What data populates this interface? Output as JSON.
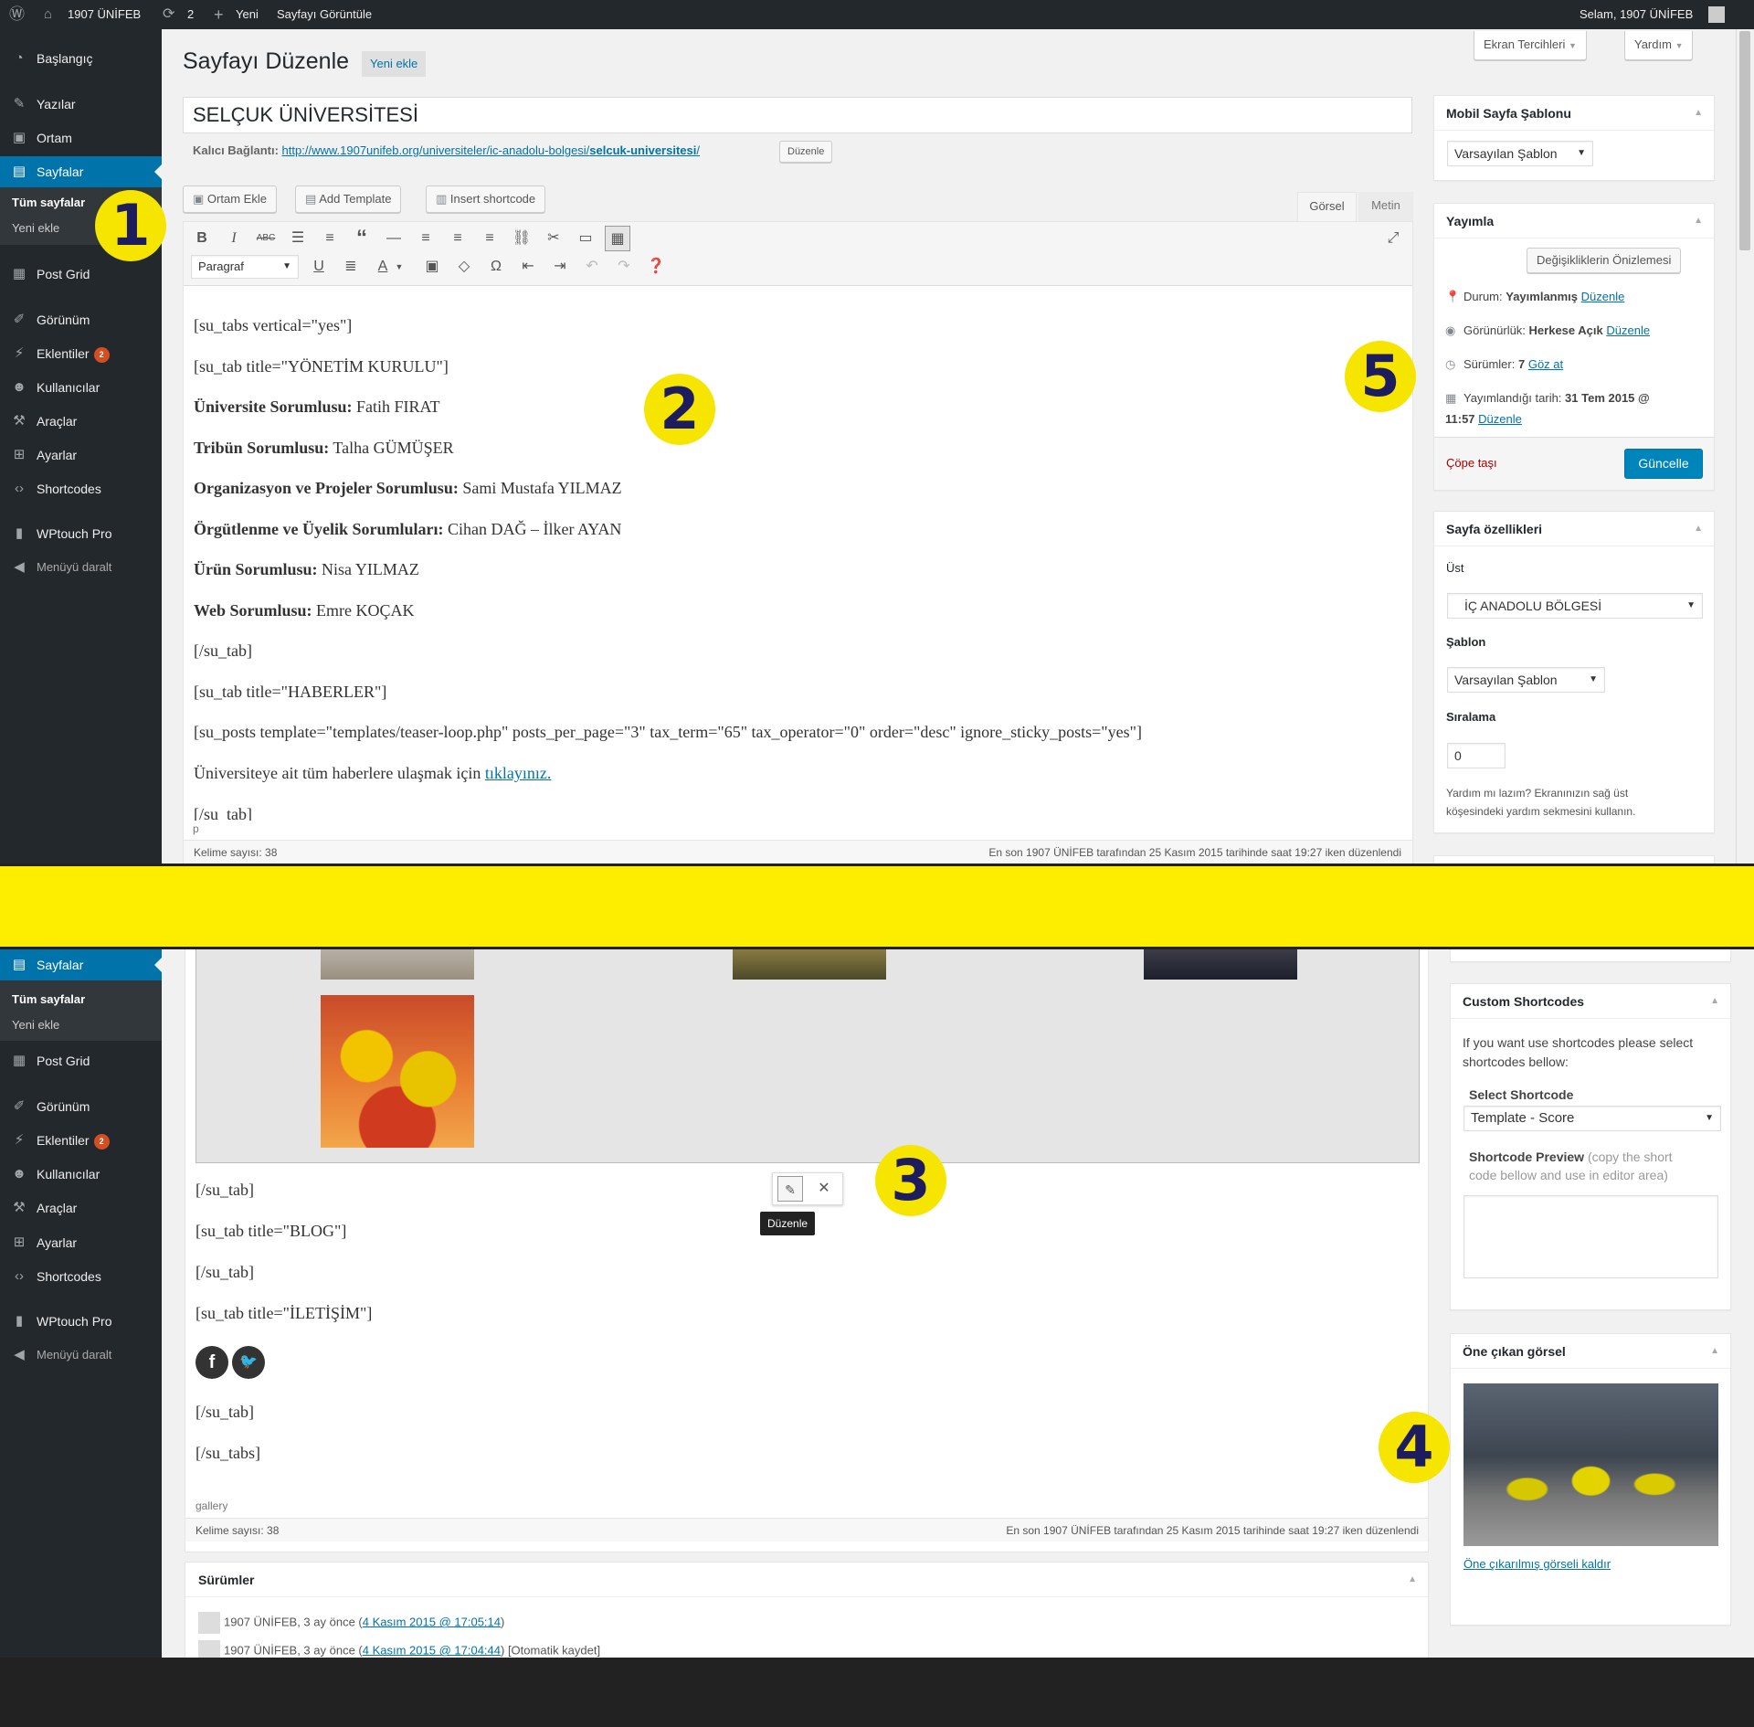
{
  "admin_bar": {
    "site_name": "1907 ÜNİFEB",
    "updates_count": "2",
    "new_label": "Yeni",
    "view_page": "Sayfayı Görüntüle",
    "greeting": "Selam, 1907 ÜNİFEB"
  },
  "sidebar": {
    "dashboard": "Başlangıç",
    "posts": "Yazılar",
    "media": "Ortam",
    "pages": "Sayfalar",
    "all_pages": "Tüm sayfalar",
    "add_new": "Yeni ekle",
    "post_grid": "Post Grid",
    "appearance": "Görünüm",
    "plugins": "Eklentiler",
    "plugins_badge": "2",
    "users": "Kullanıcılar",
    "tools": "Araçlar",
    "settings": "Ayarlar",
    "shortcodes": "Shortcodes",
    "wptouch": "WPtouch Pro",
    "collapse": "Menüyü daralt"
  },
  "header": {
    "screen_options": "Ekran Tercihleri",
    "help": "Yardım",
    "title": "Sayfayı Düzenle",
    "add_new": "Yeni ekle"
  },
  "editor": {
    "post_title": "SELÇUK ÜNİVERSİTESİ",
    "permalink_label": "Kalıcı Bağlantı:",
    "permalink_url_prefix": "http://www.1907unifeb.org/universiteler/ic-anadolu-bolgesi/",
    "permalink_slug": "selcuk-universitesi",
    "permalink_suffix": "/",
    "permalink_edit": "Düzenle",
    "add_media": "Ortam Ekle",
    "add_template": "Add Template",
    "insert_shortcode": "Insert shortcode",
    "tab_visual": "Görsel",
    "tab_text": "Metin",
    "format_select": "Paragraf",
    "lines": [
      {
        "plain": "[su_tabs vertical=\"yes\"]"
      },
      {
        "plain": "[su_tab title=\"YÖNETİM KURULU\"]"
      },
      {
        "bold": "Üniversite Sorumlusu:",
        "plain": " Fatih FIRAT"
      },
      {
        "bold": "Tribün Sorumlusu:",
        "plain": " Talha GÜMÜŞER"
      },
      {
        "bold": "Organizasyon ve Projeler Sorumlusu:",
        "plain": " Sami Mustafa YILMAZ"
      },
      {
        "bold": "Örgütlenme ve Üyelik Sorumluları:",
        "plain": " Cihan DAĞ – İlker AYAN"
      },
      {
        "bold": "Ürün Sorumlusu:",
        "plain": " Nisa YILMAZ"
      },
      {
        "bold": "Web Sorumlusu:",
        "plain": " Emre KOÇAK"
      },
      {
        "plain": "[/su_tab]"
      },
      {
        "plain": "[su_tab title=\"HABERLER\"]"
      },
      {
        "plain": "[su_posts template=\"templates/teaser-loop.php\" posts_per_page=\"3\" tax_term=\"65\" tax_operator=\"0\" order=\"desc\" ignore_sticky_posts=\"yes\"]"
      }
    ],
    "news_line_text": "Üniversiteye ait tüm haberlere ulaşmak için ",
    "news_line_link": "tıklayınız.",
    "cut_line": "[/su_tab]",
    "path_top": "p",
    "word_count": "Kelime sayısı: 38",
    "last_edited": "En son 1907 ÜNİFEB tarafından 25 Kasım 2015 tarihinde saat 19:27 iken düzenlendi",
    "lower_lines": [
      "[/su_tab]",
      "[su_tab title=\"BLOG\"]",
      "[/su_tab]",
      "[su_tab title=\"İLETİŞİM\"]"
    ],
    "lower_end": [
      "[/su_tab]",
      "[/su_tabs]"
    ],
    "path_bottom": "gallery",
    "gallery_tooltip": "Düzenle"
  },
  "mobile_template": {
    "title": "Mobil Sayfa Şablonu",
    "value": "Varsayılan Şablon"
  },
  "publish": {
    "title": "Yayımla",
    "preview": "Değişikliklerin Önizlemesi",
    "status_label": "Durum:",
    "status_value": "Yayımlanmış",
    "visibility_label": "Görünürlük:",
    "visibility_value": "Herkese Açık",
    "revisions_label": "Sürümler:",
    "revisions_value": "7",
    "revisions_link": "Göz at",
    "published_label": "Yayımlandığı tarih:",
    "published_value_1": "31 Tem 2015 @",
    "published_value_2": "11:57",
    "edit": "Düzenle",
    "trash": "Çöpe taşı",
    "update": "Güncelle"
  },
  "page_attributes": {
    "title": "Sayfa özellikleri",
    "parent_label": "Üst",
    "parent_value": "İÇ ANADOLU BÖLGESİ",
    "template_label": "Şablon",
    "template_value": "Varsayılan Şablon",
    "order_label": "Sıralama",
    "order_value": "0",
    "help_text_1": "Yardım mı lazım? Ekranınızın sağ üst",
    "help_text_2": "köşesindeki yardım sekmesini kullanın."
  },
  "custom_shortcodes": {
    "title": "Custom Shortcodes",
    "intro_1": "If you want use shortcodes please select",
    "intro_2": "shortcodes bellow:",
    "select_label": "Select Shortcode",
    "select_value": "Template - Score",
    "preview_label": "Shortcode Preview",
    "preview_hint_1": "(copy the short",
    "preview_hint_2": "code bellow and use in editor area)"
  },
  "featured_image": {
    "title": "Öne çıkan görsel",
    "remove": "Öne çıkarılmış görseli kaldır"
  },
  "revisions": {
    "title": "Sürümler",
    "items": [
      {
        "author": "1907 ÜNİFEB, 3 ay önce (",
        "link": "4 Kasım 2015 @ 17:05:14",
        "tail": ")"
      },
      {
        "author": "1907 ÜNİFEB, 3 ay önce (",
        "link": "4 Kasım 2015 @ 17:04:44",
        "tail": ") [Otomatik kaydet]"
      }
    ]
  },
  "annotations": [
    "1",
    "2",
    "3",
    "4",
    "5"
  ],
  "colors": {
    "accent": "#0073aa",
    "marker": "#f6e500",
    "marker_text": "#1c1c5e",
    "admin_dark": "#23282d"
  }
}
